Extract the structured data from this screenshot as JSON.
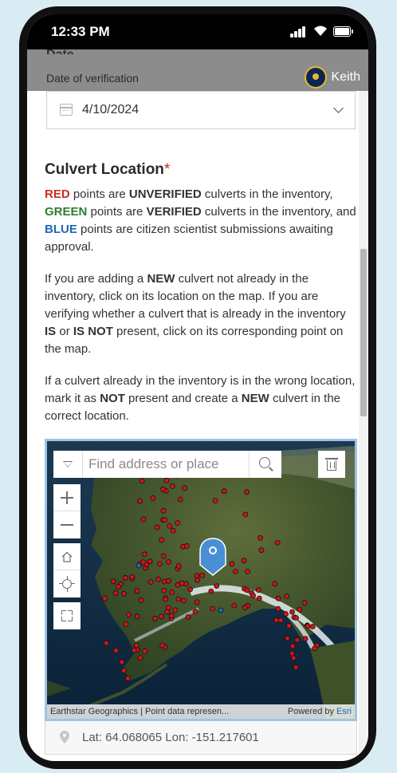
{
  "status_bar": {
    "time": "12:33 PM"
  },
  "header": {
    "date_label": "Date",
    "date_description": "Date of verification",
    "user_name": "Keith"
  },
  "date_field": {
    "value": "4/10/2024"
  },
  "culvert_section": {
    "title": "Culvert Location",
    "required_mark": "*",
    "legend": {
      "red_word": "RED",
      "red_text": " points are ",
      "unverified": "UNVERIFIED",
      "red_tail": " culverts in the inventory,",
      "green_word": "GREEN",
      "green_text": " points are ",
      "verified": "VERIFIED",
      "green_tail": " culverts in the inventory, and ",
      "blue_word": "BLUE",
      "blue_tail": " points are citizen scientist submissions awaiting approval."
    },
    "para2": {
      "a": "If you are adding a ",
      "new1": "NEW",
      "b": " culvert not already in the inventory, click on its location on the map. If you are verifying whether a culvert that is already in the inventory ",
      "is": "IS",
      "c": " or ",
      "isnot": "IS NOT",
      "d": " present, click on its corresponding point on the map."
    },
    "para3": {
      "a": "If a culvert already in the inventory is in the wrong location, mark it as ",
      "not": "NOT",
      "b": " present and create a ",
      "new2": "NEW",
      "c": " culvert in the correct location."
    }
  },
  "map": {
    "search_placeholder": "Find address or place",
    "attribution": "Earthstar Geographics | Point data represen...",
    "powered_by": "Powered by ",
    "esri": "Esri",
    "colors": {
      "unverified": "#d0141b",
      "submitted": "#1f67b3",
      "marker": "#4a8fd6"
    }
  },
  "coordinates": {
    "text": "Lat: 64.068065  Lon: -151.217601"
  },
  "icons": {
    "calendar": "calendar-icon",
    "search": "search-icon",
    "trash": "trash-icon",
    "home": "home-icon",
    "locate": "locate-icon",
    "fullscreen": "fullscreen-icon",
    "pin": "map-pin-icon"
  }
}
